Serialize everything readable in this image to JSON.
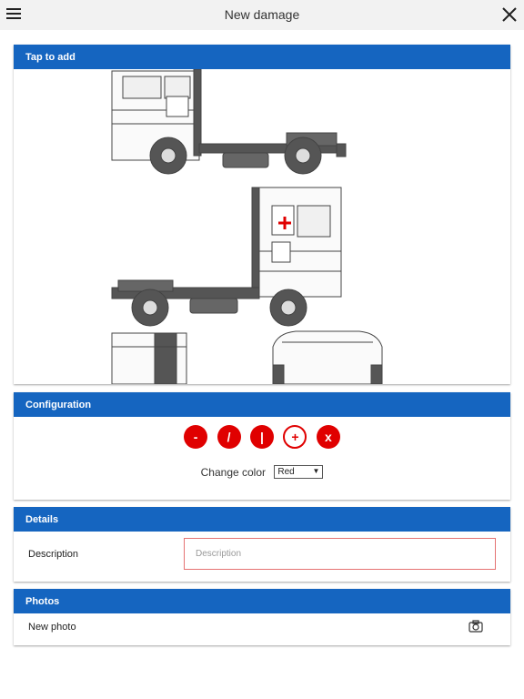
{
  "header": {
    "title": "New damage",
    "menu_icon": "hamburger-menu-icon",
    "close_icon": "close-icon"
  },
  "tap_section": {
    "title": "Tap to add"
  },
  "configuration": {
    "title": "Configuration",
    "tools": [
      {
        "label": "-",
        "name": "dash"
      },
      {
        "label": "/",
        "name": "slash"
      },
      {
        "label": "|",
        "name": "vertical-line"
      },
      {
        "label": "+",
        "name": "plus",
        "selected": true
      },
      {
        "label": "x",
        "name": "cross"
      }
    ],
    "change_color_label": "Change color",
    "color_value": "Red",
    "accent_color": "#e00000"
  },
  "details": {
    "title": "Details",
    "description_label": "Description",
    "description_placeholder": "Description"
  },
  "photos": {
    "title": "Photos",
    "new_photo_label": "New photo",
    "camera_icon": "camera-icon"
  },
  "colors": {
    "header_blue": "#1565c0",
    "marker_red": "#e00000"
  }
}
